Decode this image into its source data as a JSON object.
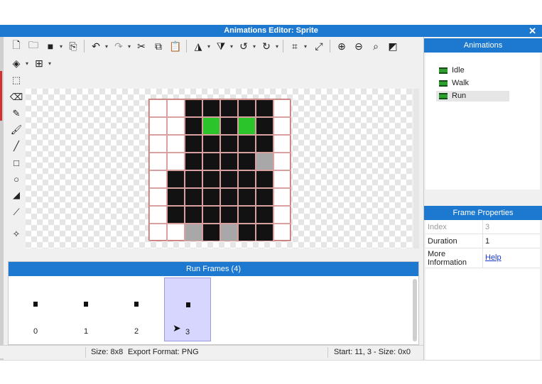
{
  "window": {
    "title": "Animations Editor: Sprite",
    "close_symbol": "✕"
  },
  "toolbar": {
    "icons": [
      "new-file-icon",
      "open-folder-icon",
      "save-icon",
      "save-as-icon",
      "undo-icon",
      "redo-icon",
      "cut-icon",
      "copy-icon",
      "paste-icon",
      "flip-horizontal-icon",
      "flip-vertical-icon",
      "rotate-left-icon",
      "rotate-right-icon",
      "crop-icon",
      "resize-icon",
      "zoom-in-icon",
      "zoom-out-icon",
      "zoom-fit-icon",
      "invert-icon",
      "layers-icon",
      "grid-icon"
    ]
  },
  "tools": [
    "select-tool-icon",
    "eraser-tool-icon",
    "pencil-tool-icon",
    "brush-tool-icon",
    "line-tool-icon",
    "rectangle-tool-icon",
    "ellipse-tool-icon",
    "fill-tool-icon",
    "eyedropper-tool-icon",
    "pivot-tool-icon"
  ],
  "sprite": {
    "colors": {
      "K": "#121212",
      "G": "#2bc42b",
      "A": "#a8a8a8",
      "T": "transparent"
    },
    "pixels": [
      "TTKKKKKT",
      "TTKGKGKT",
      "TTKKKKKT",
      "TTKKKKAT",
      "TKKKKKKT",
      "TKKKKKKT",
      "TKKKKKKT",
      "TTAKAKKT"
    ]
  },
  "frames": {
    "header": "Run Frames (4)",
    "items": [
      {
        "index": "0",
        "selected": false
      },
      {
        "index": "1",
        "selected": false
      },
      {
        "index": "2",
        "selected": false
      },
      {
        "index": "3",
        "selected": true
      }
    ]
  },
  "status": {
    "size": "Size: 8x8",
    "export": "Export Format: PNG",
    "start": "Start: 11, 3 - Size: 0x0"
  },
  "animations": {
    "header": "Animations",
    "items": [
      {
        "label": "Idle",
        "selected": false
      },
      {
        "label": "Walk",
        "selected": false
      },
      {
        "label": "Run",
        "selected": true
      }
    ]
  },
  "frame_properties": {
    "header": "Frame Properties",
    "index_label": "Index",
    "index_value": "3",
    "duration_label": "Duration",
    "duration_value": "1",
    "more_label_1": "More",
    "more_label_2": "Information",
    "help_link": "Help"
  },
  "colors": {
    "accent": "#1d79d0",
    "selection": "#d6d6ff"
  }
}
